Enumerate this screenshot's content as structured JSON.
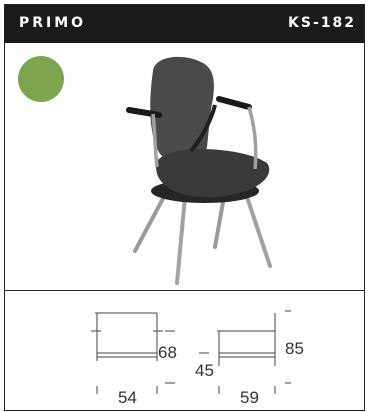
{
  "header": {
    "brand": "PRIMO",
    "code": "KS-182"
  },
  "color_swatch": {
    "color": "#7ba64e",
    "icon": "color-swatch"
  },
  "product_image": {
    "icon": "chair-icon"
  },
  "dimensions": {
    "front": {
      "height": "68",
      "width": "54"
    },
    "side": {
      "seat_height": "45",
      "height": "85",
      "depth": "59"
    }
  }
}
